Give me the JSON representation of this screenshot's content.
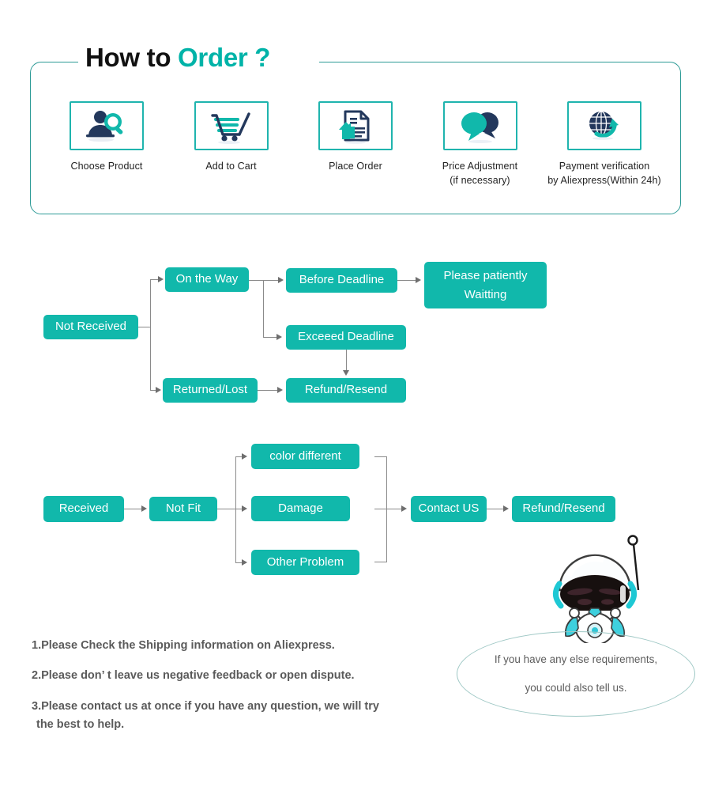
{
  "header": {
    "title_part1": "How to ",
    "title_part2": "Order ?",
    "accent_color": "#00b3a8",
    "border_color": "#2e9b97"
  },
  "steps": [
    {
      "icon": "person-search-icon",
      "label": "Choose  Product",
      "sub": ""
    },
    {
      "icon": "shopping-cart-icon",
      "label": "Add to Cart",
      "sub": ""
    },
    {
      "icon": "document-upload-icon",
      "label": "Place  Order",
      "sub": ""
    },
    {
      "icon": "speech-bubbles-icon",
      "label": "Price Adjustment",
      "sub": "(if necessary)"
    },
    {
      "icon": "globe-refresh-icon",
      "label": "Payment verification",
      "sub": "by Aliexpress(Within 24h)"
    }
  ],
  "flow_not_received": {
    "nodes": {
      "not_received": "Not Received",
      "on_the_way": "On the Way",
      "before_deadline": "Before Deadline",
      "please_waiting": "Please patiently\nWaitting",
      "exceeed_deadline": "Exceeed Deadline",
      "returned_lost": "Returned/Lost",
      "refund_resend": "Refund/Resend"
    }
  },
  "flow_received": {
    "nodes": {
      "received": "Received",
      "not_fit": "Not Fit",
      "color_different": "color different",
      "damage": "Damage",
      "other_problem": "Other Problem",
      "contact_us": "Contact US",
      "refund_resend": "Refund/Resend"
    }
  },
  "notes": {
    "line1": "1.Please Check the Shipping information on Aliexpress.",
    "line2": "2.Please don’ t leave us negative feedback or open dispute.",
    "line3": "3.Please contact us at once if you have any question, we will try",
    "line3_cont": "the best to help."
  },
  "speech": {
    "line1": "If you have any else requirements,",
    "line2": "you could also tell us."
  },
  "colors": {
    "node_bg": "#11b8ab",
    "connector": "#8a8a8a",
    "icon_dark": "#23385c",
    "icon_teal": "#11b8ab"
  }
}
